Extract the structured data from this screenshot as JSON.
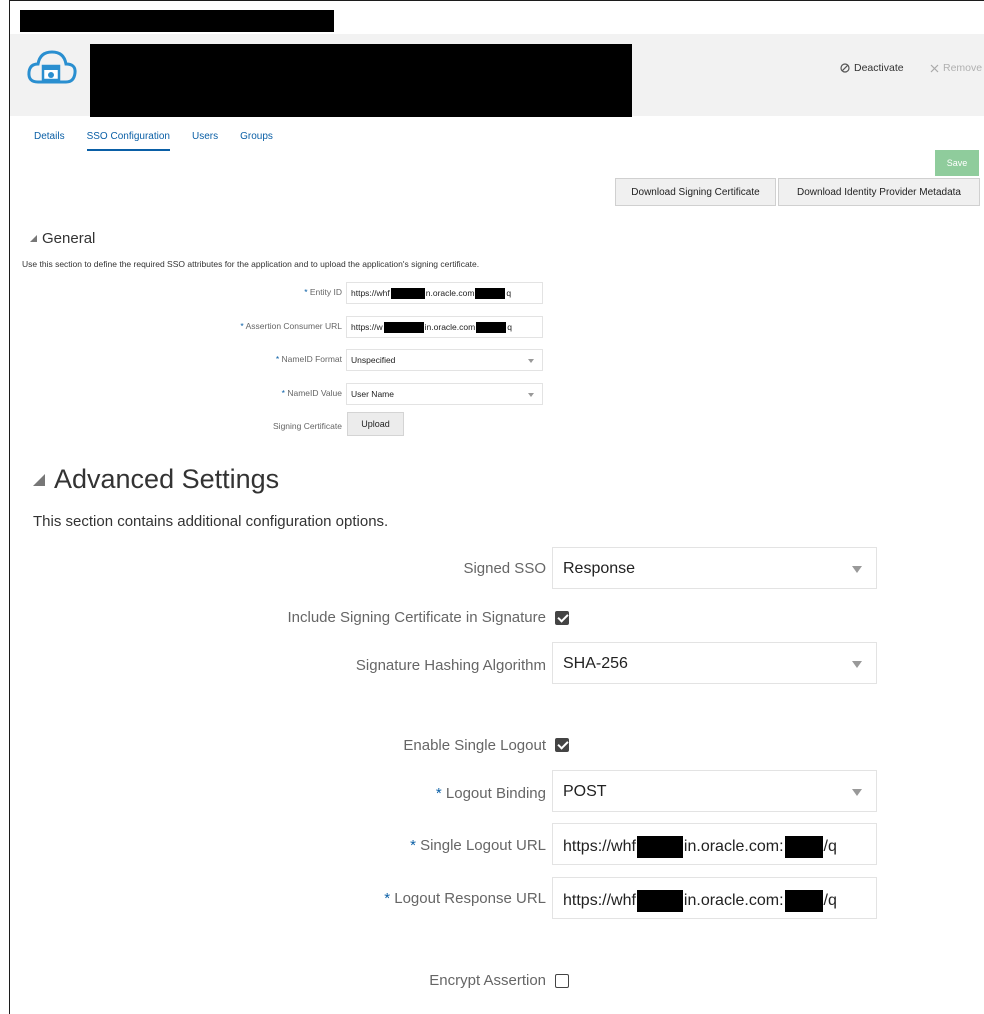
{
  "header": {
    "deactivate_label": "Deactivate",
    "remove_label": "Remove",
    "deactivate_icon": "ban-icon",
    "remove_icon": "close-icon"
  },
  "tabs": [
    {
      "label": "Details",
      "active": false
    },
    {
      "label": "SSO Configuration",
      "active": true
    },
    {
      "label": "Users",
      "active": false
    },
    {
      "label": "Groups",
      "active": false
    }
  ],
  "actions": {
    "save_label": "Save",
    "download_signing_label": "Download Signing Certificate",
    "download_metadata_label": "Download Identity Provider Metadata"
  },
  "general": {
    "title": "General",
    "description": "Use this section to define the required SSO attributes for the application and to upload the application's signing certificate.",
    "entity_id_label": "Entity ID",
    "entity_id_value_a": "https://whf",
    "entity_id_value_b": "n.oracle.com",
    "entity_id_value_c": "q",
    "acs_label": "Assertion Consumer URL",
    "acs_value_a": "https://w",
    "acs_value_b": "in.oracle.com",
    "acs_value_c": "q",
    "nameid_format_label": "NameID Format",
    "nameid_format_value": "Unspecified",
    "nameid_value_label": "NameID Value",
    "nameid_value_value": "User Name",
    "signing_cert_label": "Signing Certificate",
    "upload_label": "Upload"
  },
  "advanced": {
    "title": "Advanced Settings",
    "description": "This section contains additional configuration options.",
    "signed_sso_label": "Signed SSO",
    "signed_sso_value": "Response",
    "include_cert_label": "Include Signing Certificate in Signature",
    "include_cert_checked": true,
    "hash_label": "Signature Hashing Algorithm",
    "hash_value": "SHA-256",
    "single_logout_label": "Enable Single Logout",
    "single_logout_checked": true,
    "logout_binding_label": "Logout Binding",
    "logout_binding_value": "POST",
    "slo_url_label": "Single Logout URL",
    "slo_url_a": "https://whf",
    "slo_url_b": "in.oracle.com:",
    "slo_url_c": "/q",
    "logout_resp_label": "Logout Response URL",
    "logout_resp_a": "https://whf",
    "logout_resp_b": "in.oracle.com:",
    "logout_resp_c": "/q",
    "encrypt_label": "Encrypt Assertion",
    "encrypt_checked": false
  },
  "colors": {
    "accent": "#0a5fa6",
    "save_bg": "#8fcc9c",
    "header_bg": "#f2f2f2"
  }
}
